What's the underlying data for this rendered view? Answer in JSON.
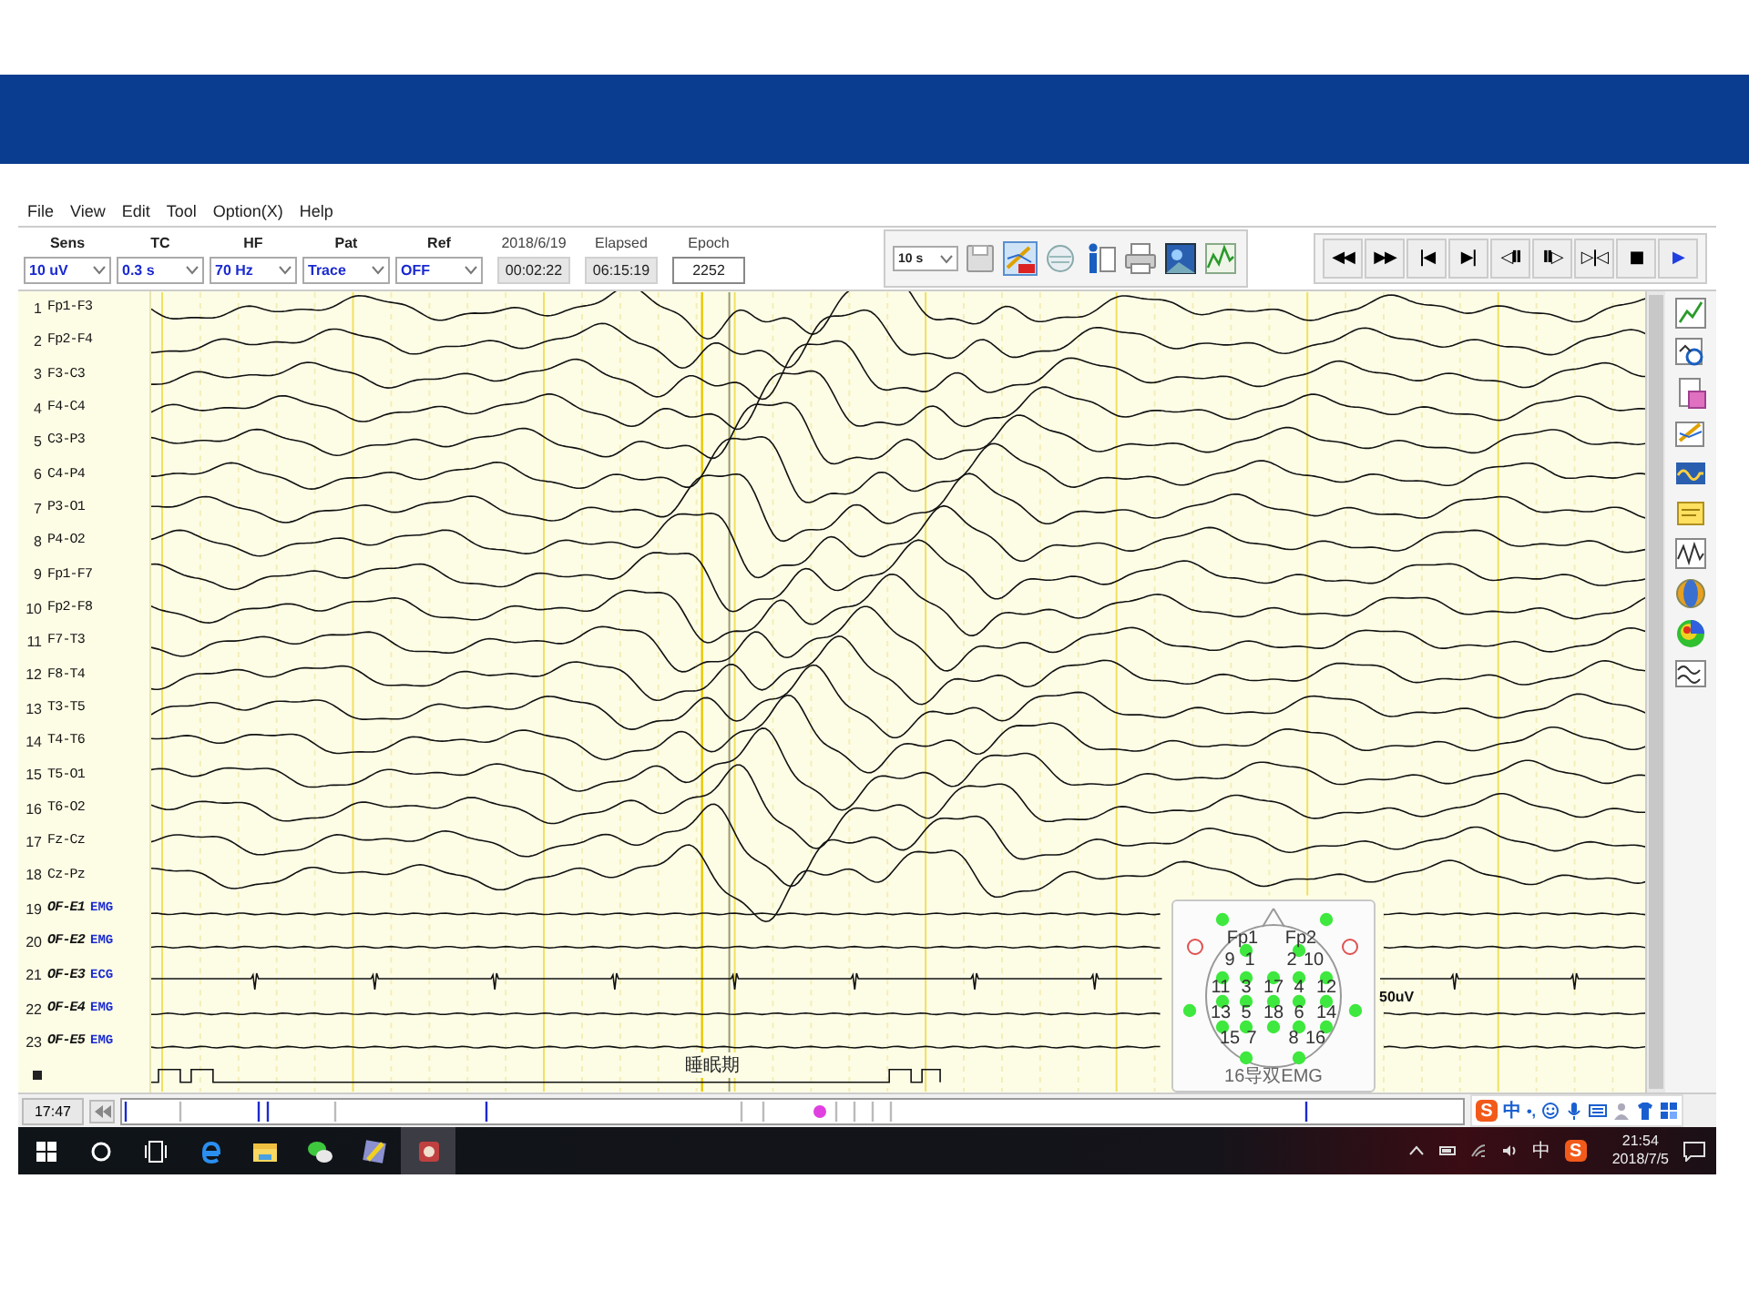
{
  "menu": [
    "File",
    "View",
    "Edit",
    "Tool",
    "Option(X)",
    "Help"
  ],
  "settings": [
    {
      "label": "Sens",
      "value": "10 uV"
    },
    {
      "label": "TC",
      "value": "0.3 s"
    },
    {
      "label": "HF",
      "value": "70 Hz"
    },
    {
      "label": "Pat",
      "value": "Trace"
    },
    {
      "label": "Ref",
      "value": "OFF"
    }
  ],
  "readouts": [
    {
      "label": "2018/6/19",
      "value": "00:02:22"
    },
    {
      "label": "Elapsed",
      "value": "06:15:19"
    },
    {
      "label": "Epoch",
      "value": "2252"
    }
  ],
  "page_length": "10 s",
  "transport": [
    {
      "glyph": "◀◀",
      "color": "#000000"
    },
    {
      "glyph": "▶▶",
      "color": "#000000"
    },
    {
      "glyph": "|◀",
      "color": "#000000"
    },
    {
      "glyph": "▶|",
      "color": "#000000"
    },
    {
      "glyph": "◁II",
      "color": "#000000"
    },
    {
      "glyph": "II▷",
      "color": "#000000"
    },
    {
      "glyph": "▷|◁",
      "color": "#000000"
    },
    {
      "glyph": "■",
      "color": "#000000"
    },
    {
      "glyph": "▶",
      "color": "#1f3fe0"
    }
  ],
  "channels": [
    {
      "number": "1",
      "label": "Fp1-F3",
      "kind": "eeg"
    },
    {
      "number": "2",
      "label": "Fp2-F4",
      "kind": "eeg"
    },
    {
      "number": "3",
      "label": "F3-C3",
      "kind": "eeg"
    },
    {
      "number": "4",
      "label": "F4-C4",
      "kind": "eeg"
    },
    {
      "number": "5",
      "label": "C3-P3",
      "kind": "eeg"
    },
    {
      "number": "6",
      "label": "C4-P4",
      "kind": "eeg"
    },
    {
      "number": "7",
      "label": "P3-O1",
      "kind": "eeg"
    },
    {
      "number": "8",
      "label": "P4-O2",
      "kind": "eeg"
    },
    {
      "number": "9",
      "label": "Fp1-F7",
      "kind": "eeg"
    },
    {
      "number": "10",
      "label": "Fp2-F8",
      "kind": "eeg"
    },
    {
      "number": "11",
      "label": "F7-T3",
      "kind": "eeg"
    },
    {
      "number": "12",
      "label": "F8-T4",
      "kind": "eeg"
    },
    {
      "number": "13",
      "label": "T3-T5",
      "kind": "eeg"
    },
    {
      "number": "14",
      "label": "T4-T6",
      "kind": "eeg"
    },
    {
      "number": "15",
      "label": "T5-O1",
      "kind": "eeg"
    },
    {
      "number": "16",
      "label": "T6-O2",
      "kind": "eeg"
    },
    {
      "number": "17",
      "label": "Fz-Cz",
      "kind": "eeg"
    },
    {
      "number": "18",
      "label": "Cz-Pz",
      "kind": "eeg"
    },
    {
      "number": "19",
      "label": "OF-E1",
      "kind": "emg",
      "tag": "EMG"
    },
    {
      "number": "20",
      "label": "OF-E2",
      "kind": "emg",
      "tag": "EMG"
    },
    {
      "number": "21",
      "label": "OF-E3",
      "kind": "ecg",
      "tag": "ECG"
    },
    {
      "number": "22",
      "label": "OF-E4",
      "kind": "emg",
      "tag": "EMG"
    },
    {
      "number": "23",
      "label": "OF-E5",
      "kind": "emg",
      "tag": "EMG"
    },
    {
      "kind": "trigger"
    }
  ],
  "annotation": "睡眠期",
  "scale_label": "50uV",
  "head_map": {
    "electrodes": [
      "Fp1",
      "Fp2"
    ],
    "numbers": [
      "9",
      "1",
      "2",
      "10",
      "11",
      "3",
      "17",
      "4",
      "12",
      "13",
      "5",
      "18",
      "6",
      "14",
      "15",
      "7",
      "8",
      "16"
    ],
    "montage": "16导双EMG"
  },
  "timeline": {
    "time": "17:47"
  },
  "ime_bar": {
    "logo": "S",
    "mode": "中",
    "punctuation": "•,"
  },
  "taskbar": {
    "language": "中",
    "logo": "S",
    "time": "21:54",
    "date": "2018/7/5"
  }
}
